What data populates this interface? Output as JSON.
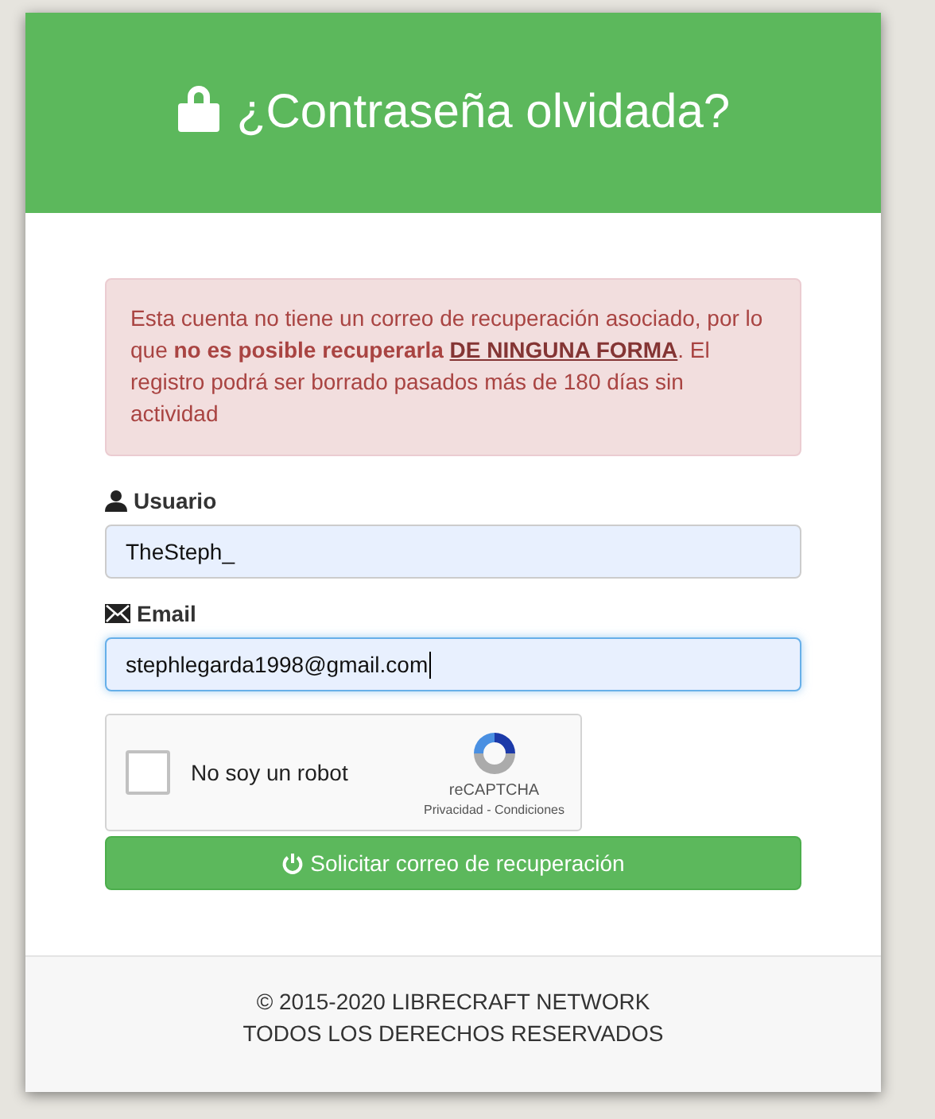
{
  "header": {
    "title": "¿Contraseña olvidada?"
  },
  "alert": {
    "parts": [
      {
        "kind": "text",
        "text": "Esta cuenta no tiene un correo de recuperación asociado, por lo que "
      },
      {
        "kind": "bold",
        "text": "no es posible recuperarla"
      },
      {
        "kind": "link",
        "text": "DE NINGUNA FORMA"
      },
      {
        "kind": "text",
        "text": ". El registro podrá ser borrado pasados más de 180 días sin actividad"
      }
    ]
  },
  "fields": [
    {
      "kind": "user",
      "label": "Usuario",
      "value": "TheSteph_",
      "focused": false
    },
    {
      "kind": "email",
      "label": "Email",
      "value": "stephlegarda1998@gmail.com",
      "focused": true
    }
  ],
  "captcha": {
    "label": "No soy un robot",
    "checked": false,
    "brand": "reCAPTCHA",
    "links": "Privacidad - Condiciones"
  },
  "submit": {
    "label": "Solicitar correo de recuperación"
  },
  "footer": {
    "lines": [
      "© 2015-2020 LIBRECRAFT NETWORK",
      "TODOS LOS DERECHOS RESERVADOS"
    ]
  }
}
